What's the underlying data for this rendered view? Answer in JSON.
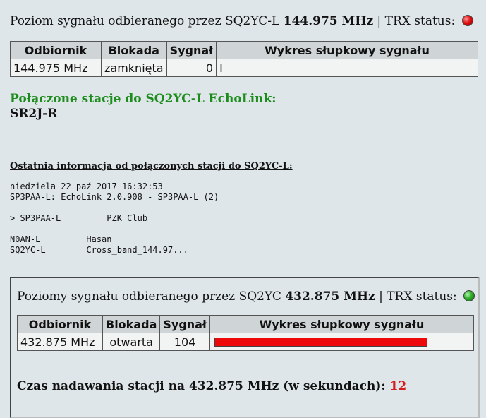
{
  "rx1": {
    "prefix": "Poziom sygnału odbieranego przez SQ2YC-L",
    "freq": "144.975 MHz",
    "sep": "| TRX status:",
    "status_color": "#e01010",
    "headers": [
      "Odbiornik",
      "Blokada",
      "Sygnał",
      "Wykres słupkowy sygnału"
    ],
    "row": {
      "receiver": "144.975 MHz",
      "squelch": "zamknięta",
      "signal": "0",
      "bar_text": "I"
    }
  },
  "connected": {
    "title": "Połączone stacje do SQ2YC-L EchoLink:",
    "station": "SR2J-R"
  },
  "last_info": {
    "title": "Ostatnia informacja od połączonych stacji do SQ2YC-L:",
    "date": "niedziela 22 paź 2017 16:32:53",
    "line2": "SP3PAA-L: EchoLink 2.0.908 - SP3PAA-L (2)",
    "line3": "> SP3PAA-L         PZK Club",
    "line4": "N0AN-L         Hasan",
    "line5": "SQ2YC-L        Cross_band_144.97..."
  },
  "rx2": {
    "prefix": "Poziomy sygnału odbieranego przez SQ2YC",
    "freq": "432.875 MHz",
    "sep": "| TRX status:",
    "status_color": "#2fae2a",
    "headers": [
      "Odbiornik",
      "Blokada",
      "Sygnał",
      "Wykres słupkowy sygnału"
    ],
    "row": {
      "receiver": "432.875 MHz",
      "squelch": "otwarta",
      "signal": "104",
      "bar_fraction": 0.83,
      "bar_color": "#ee0a0a"
    }
  },
  "tx_time": {
    "label": "Czas nadawania stacji na 432.875 MHz (w sekundach):",
    "value": "12"
  }
}
